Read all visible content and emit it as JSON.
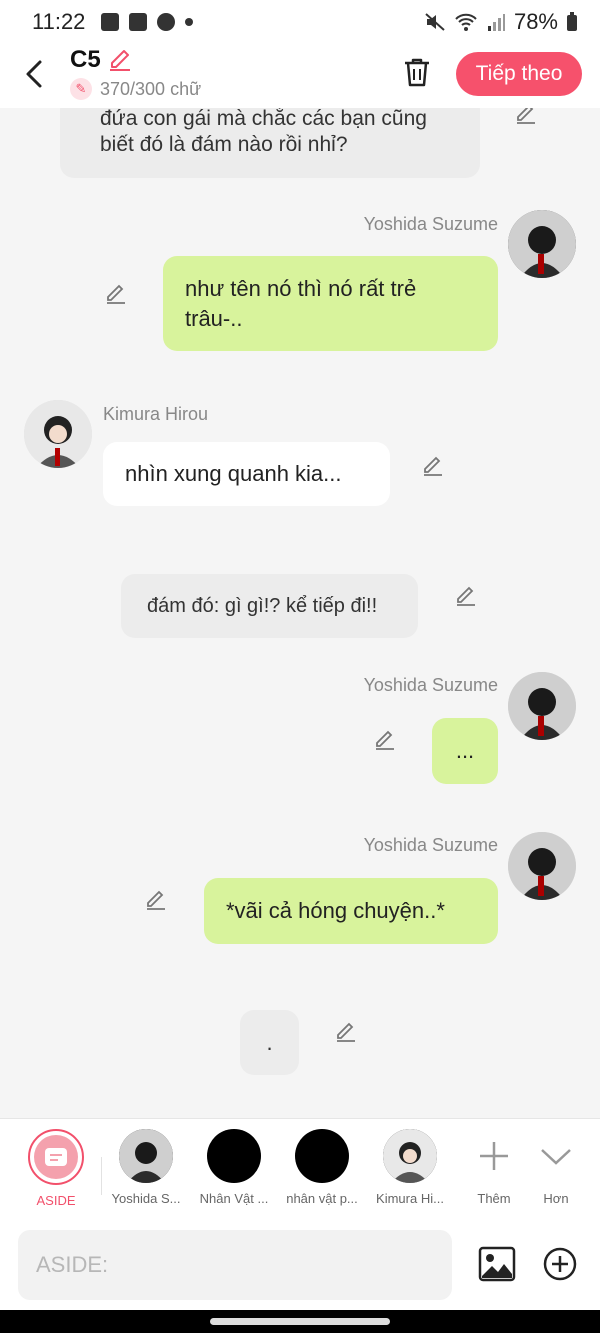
{
  "status": {
    "time": "11:22",
    "battery": "78%"
  },
  "header": {
    "chapter": "C5",
    "word_count": "370/300 chữ",
    "next_label": "Tiếp theo"
  },
  "messages": [
    {
      "type": "narration",
      "text": "đứa con gái mà chắc các bạn cũng biết đó là đám nào rồi nhỉ?"
    },
    {
      "type": "right",
      "speaker": "Yoshida Suzume",
      "text": "như tên nó thì nó rất trẻ trâu-.."
    },
    {
      "type": "left",
      "speaker": "Kimura Hirou",
      "text": "nhìn xung quanh kia..."
    },
    {
      "type": "narration",
      "text": "đám đó: gì gì!? kể tiếp đi!!"
    },
    {
      "type": "right",
      "speaker": "Yoshida Suzume",
      "text": "..."
    },
    {
      "type": "right",
      "speaker": "Yoshida Suzume",
      "text": "*vãi cả hóng chuyện..*"
    },
    {
      "type": "narration",
      "text": "."
    }
  ],
  "characters": [
    {
      "label": "ASIDE"
    },
    {
      "label": "Yoshida S..."
    },
    {
      "label": "Nhân Vật ..."
    },
    {
      "label": "nhân vật p..."
    },
    {
      "label": "Kimura Hi..."
    },
    {
      "label": "Thêm"
    },
    {
      "label": "Hơn"
    }
  ],
  "input": {
    "placeholder": "ASIDE:"
  },
  "colors": {
    "accent": "#f6516c",
    "user_bubble": "#d8f39c",
    "narration_bubble": "#ececec"
  }
}
